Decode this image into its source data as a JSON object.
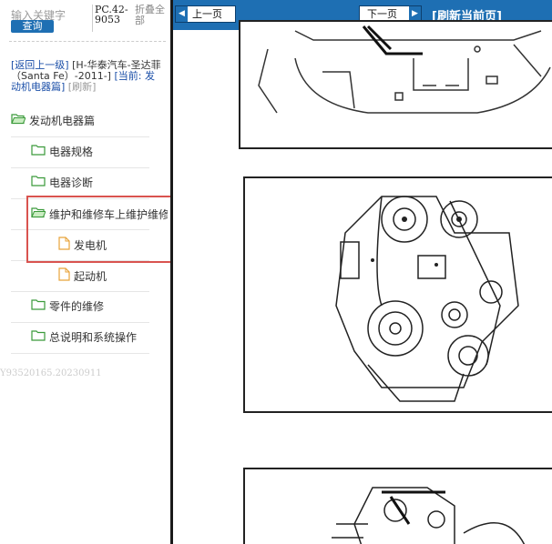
{
  "sidebar": {
    "search_placeholder": "输入关键字",
    "search_button": "查询",
    "pc_code": "PC.42-9053",
    "collapse_all": "折叠全部",
    "crumb_back": "[返回上一级]",
    "crumb_model": "[H-华泰汽车-圣达菲（Santa Fe）-2011-]",
    "crumb_current": "[当前: 发动机电器篇]",
    "crumb_refresh": "[刷新]",
    "tree": [
      {
        "label": "发动机电器篇",
        "icon": "folder-open-icon"
      },
      {
        "label": "电器规格",
        "icon": "folder-icon"
      },
      {
        "label": "电器诊断",
        "icon": "folder-icon"
      },
      {
        "label": "维护和维修车上维护维修",
        "icon": "folder-open-icon"
      },
      {
        "label": "发电机",
        "icon": "document-icon"
      },
      {
        "label": "起动机",
        "icon": "document-icon"
      },
      {
        "label": "零件的维修",
        "icon": "folder-icon"
      },
      {
        "label": "总说明和系统操作",
        "icon": "folder-icon"
      }
    ],
    "watermark": "Y93520165.20230911"
  },
  "toolbar": {
    "prev_page": "上一页",
    "next_page": "下一页",
    "refresh_page": "[刷新当前页]"
  },
  "colors": {
    "toolbar_bg": "#1e6fb3",
    "highlight": "#d9534f",
    "folder": "#3a9a3a",
    "document": "#e8a33a"
  }
}
